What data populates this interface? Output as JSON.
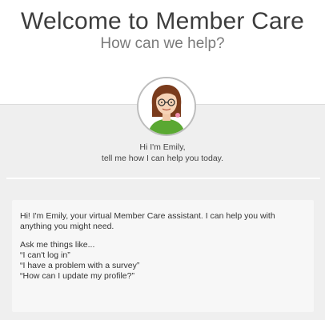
{
  "header": {
    "title": "Welcome to Member Care",
    "subtitle": "How can we help?"
  },
  "assistant": {
    "avatar_icon": "assistant-avatar-icon",
    "intro_line1": "Hi I'm Emily,",
    "intro_line2": "tell me how I can help you today."
  },
  "message": {
    "greeting": "Hi! I'm Emily, your virtual Member Care assistant. I can help you with anything you might need.",
    "prompt": "Ask me things like...",
    "examples": [
      "“I can't log in”",
      "“I have a problem with a survey”",
      "“How can I update my profile?”"
    ]
  },
  "colors": {
    "panel_bg": "#efefef",
    "bubble_bg": "#f7f7f7",
    "avatar_shirt": "#5aa832",
    "avatar_hair": "#7a3b1c"
  }
}
